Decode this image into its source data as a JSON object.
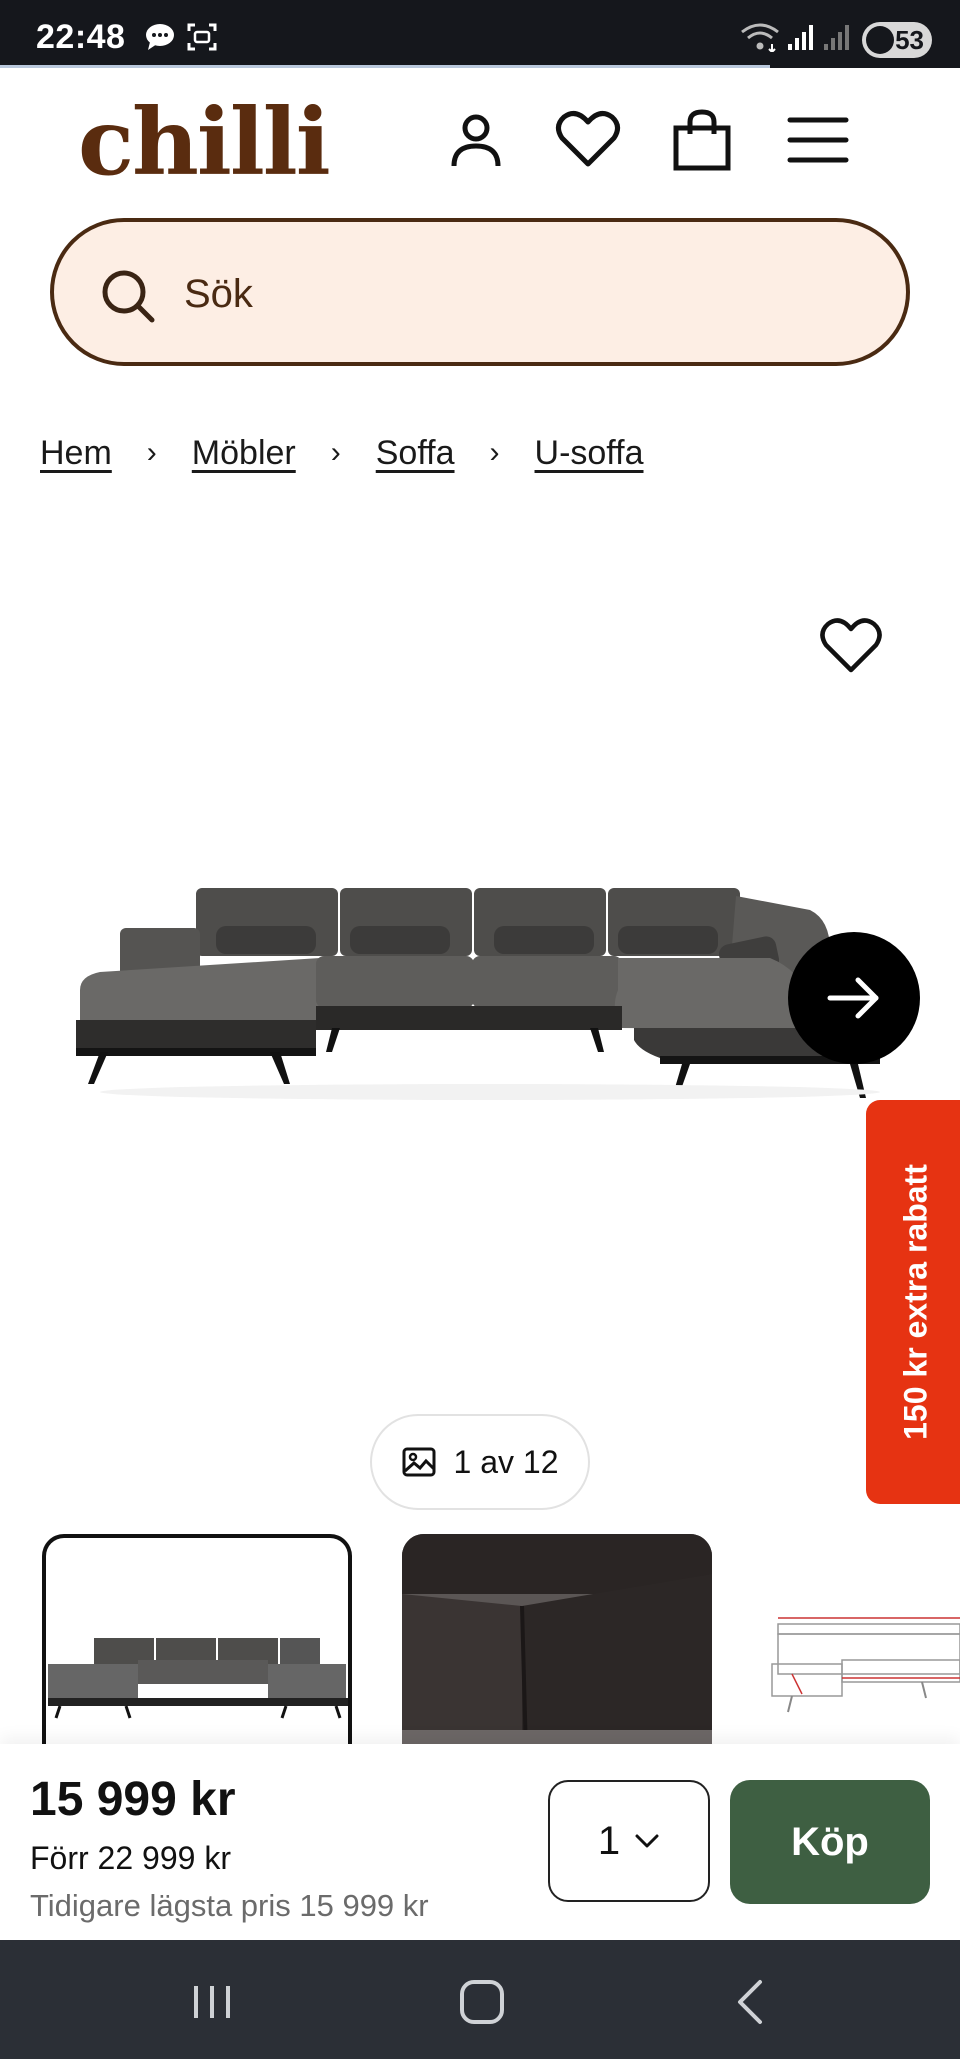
{
  "status_bar": {
    "time": "22:48",
    "battery": "53"
  },
  "header": {
    "logo": "chilli",
    "brand_color": "#5a2c0f",
    "icons": [
      "user-icon",
      "heart-icon",
      "bag-icon",
      "menu-icon"
    ]
  },
  "search": {
    "placeholder": "Sök",
    "background": "#fdeee4"
  },
  "breadcrumb": [
    {
      "label": "Hem"
    },
    {
      "label": "Möbler"
    },
    {
      "label": "Soffa"
    },
    {
      "label": "U-soffa"
    }
  ],
  "gallery": {
    "counter": "1 av 12",
    "selected_thumbnail": 1
  },
  "promo": {
    "label": "150 kr extra rabatt",
    "color": "#e63312"
  },
  "buy_bar": {
    "price": "15 999 kr",
    "previous_price": "Förr 22 999 kr",
    "lowest_price": "Tidigare lägsta pris 15 999 kr",
    "quantity": "1",
    "buy_label": "Köp",
    "buy_color": "#3e5f42"
  }
}
